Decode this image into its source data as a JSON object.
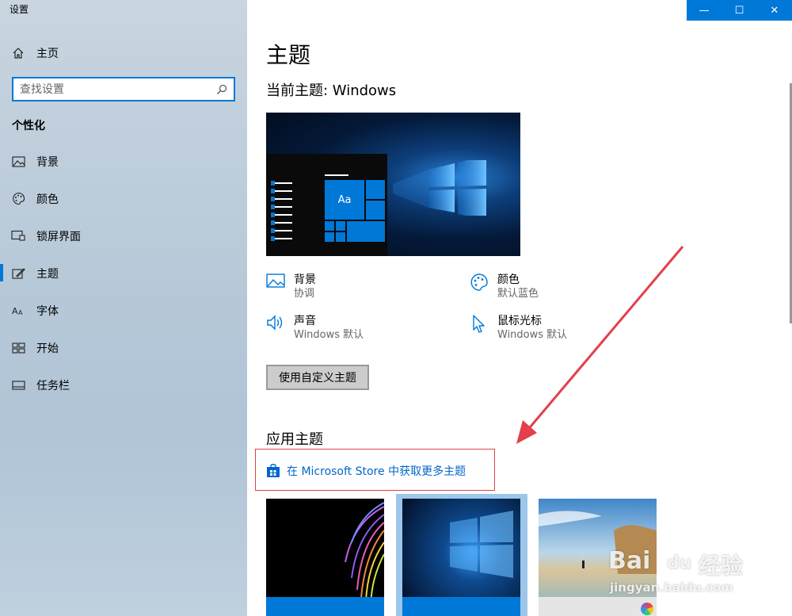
{
  "window": {
    "title": "设置",
    "minimize": "—",
    "maximize": "☐",
    "close": "✕"
  },
  "sidebar": {
    "home_label": "主页",
    "search_placeholder": "查找设置",
    "section_title": "个性化",
    "items": [
      {
        "label": "背景",
        "icon": "picture-icon"
      },
      {
        "label": "颜色",
        "icon": "palette-icon"
      },
      {
        "label": "锁屏界面",
        "icon": "lock-screen-icon"
      },
      {
        "label": "主题",
        "icon": "theme-icon",
        "active": true
      },
      {
        "label": "字体",
        "icon": "font-icon"
      },
      {
        "label": "开始",
        "icon": "start-icon"
      },
      {
        "label": "任务栏",
        "icon": "taskbar-icon"
      }
    ]
  },
  "main": {
    "title": "主题",
    "current_theme": "当前主题: Windows",
    "preview_tile_label": "Aa",
    "properties": [
      {
        "name": "背景",
        "value": "协调",
        "icon": "picture-icon"
      },
      {
        "name": "颜色",
        "value": "默认蓝色",
        "icon": "palette-icon"
      },
      {
        "name": "声音",
        "value": "Windows 默认",
        "icon": "speaker-icon"
      },
      {
        "name": "鼠标光标",
        "value": "Windows 默认",
        "icon": "cursor-icon"
      }
    ],
    "custom_button": "使用自定义主题",
    "apply_title": "应用主题",
    "store_link": "在 Microsoft Store 中获取更多主题"
  },
  "watermark": {
    "brand": "Bai",
    "brand2": "du",
    "brand_cn": "经验",
    "url": "jingyan.baidu.com"
  },
  "colors": {
    "accent": "#0078d7",
    "annotation": "#e2404a",
    "link": "#0066cc"
  }
}
